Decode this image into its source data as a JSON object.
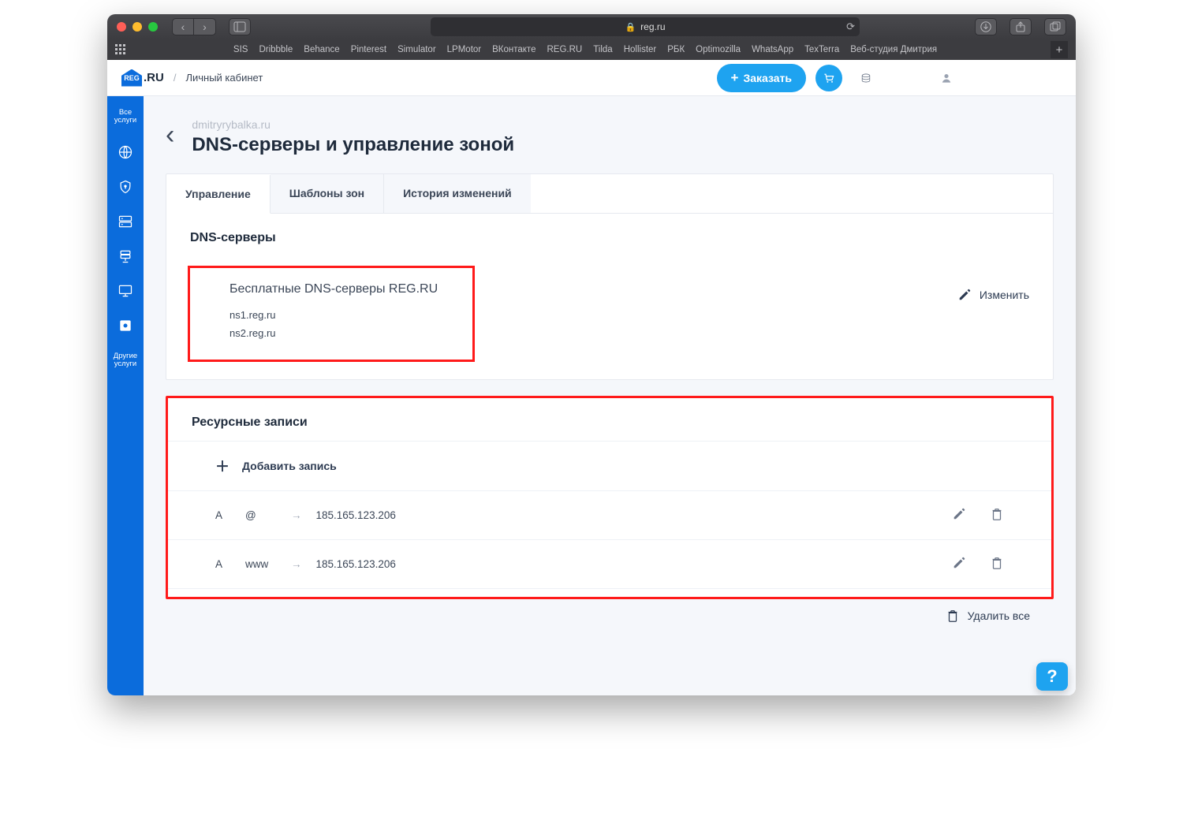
{
  "browser": {
    "url_host": "reg.ru",
    "favorites": [
      "SIS",
      "Dribbble",
      "Behance",
      "Pinterest",
      "Simulator",
      "LPMotor",
      "ВКонтакте",
      "REG.RU",
      "Tilda",
      "Hollister",
      "РБК",
      "Optimozilla",
      "WhatsApp",
      "TexTerra",
      "Веб-студия Дмитрия"
    ]
  },
  "header": {
    "logo_text": "REG",
    "logo_suffix": ".RU",
    "breadcrumb": "Личный кабинет",
    "order_label": "Заказать"
  },
  "sidebar": {
    "items": [
      {
        "label": "Все услуги",
        "icon": "none"
      },
      {
        "label": "",
        "icon": "globe"
      },
      {
        "label": "",
        "icon": "shield"
      },
      {
        "label": "",
        "icon": "server-panel"
      },
      {
        "label": "",
        "icon": "layers"
      },
      {
        "label": "",
        "icon": "monitor"
      },
      {
        "label": "",
        "icon": "disk"
      },
      {
        "label": "Другие услуги",
        "icon": "none"
      }
    ]
  },
  "page": {
    "domain": "dmitryrybalka.ru",
    "title": "DNS-серверы и управление зоной",
    "tabs": [
      "Управление",
      "Шаблоны зон",
      "История изменений"
    ],
    "active_tab": 0
  },
  "dns": {
    "section_title": "DNS-серверы",
    "subtitle": "Бесплатные DNS-серверы REG.RU",
    "ns": [
      "ns1.reg.ru",
      "ns2.reg.ru"
    ],
    "change_label": "Изменить"
  },
  "records": {
    "section_title": "Ресурсные записи",
    "add_label": "Добавить запись",
    "rows": [
      {
        "type": "A",
        "host": "@",
        "value": "185.165.123.206"
      },
      {
        "type": "A",
        "host": "www",
        "value": "185.165.123.206"
      }
    ],
    "delete_all": "Удалить все"
  }
}
